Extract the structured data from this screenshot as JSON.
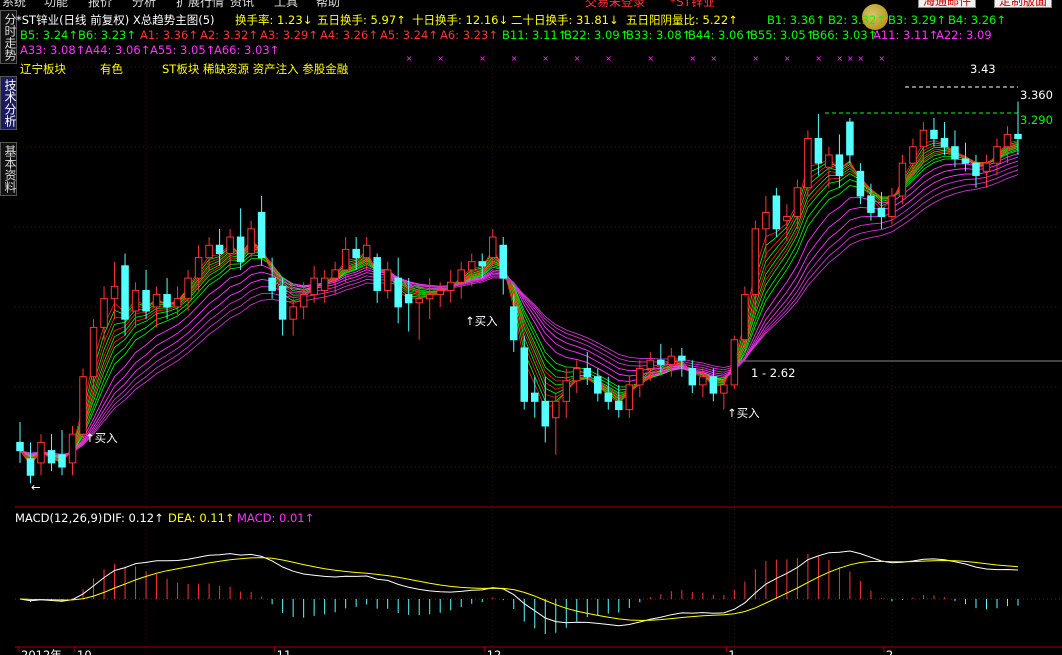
{
  "menu": {
    "items": [
      "系统",
      "功能",
      "报价",
      "分析",
      "扩展行情",
      "资讯",
      "工具",
      "帮助"
    ],
    "center": [
      "交易未登录",
      "*ST锌业"
    ],
    "buttons": [
      "海通邮件",
      "定制版面"
    ]
  },
  "sidetabs": [
    "分时走势",
    "技术分析",
    "基本资料"
  ],
  "header": {
    "title": "*ST锌业(日线 前复权) X总趋势主图(5)",
    "stats": [
      {
        "label": "换手率:",
        "value": "1.23",
        "dir": "down"
      },
      {
        "label": "五日换手:",
        "value": "5.97",
        "dir": "up"
      },
      {
        "label": "十日换手:",
        "value": "12.16",
        "dir": "down"
      },
      {
        "label": "二十日换手:",
        "value": "31.81",
        "dir": "down"
      },
      {
        "label": "五日阳阴量比:",
        "value": "5.22",
        "dir": "up"
      }
    ],
    "ma_row1": [
      {
        "name": "B1:",
        "value": "3.36",
        "dir": "up",
        "color": "#00ff00"
      },
      {
        "name": "B2:",
        "value": "3.32",
        "dir": "up",
        "color": "#00ff00"
      },
      {
        "name": "B3:",
        "value": "3.29",
        "dir": "up",
        "color": "#00ff00"
      },
      {
        "name": "B4:",
        "value": "3.26",
        "dir": "up",
        "color": "#00ff00"
      }
    ],
    "ma_row2": [
      {
        "name": "B5:",
        "value": "3.24",
        "dir": "up",
        "color": "#00ff00"
      },
      {
        "name": "B6:",
        "value": "3.23",
        "dir": "up",
        "color": "#00ff00"
      },
      {
        "name": "A1:",
        "value": "3.36",
        "dir": "up",
        "color": "#ff3333"
      },
      {
        "name": "A2:",
        "value": "3.32",
        "dir": "up",
        "color": "#ff3333"
      },
      {
        "name": "A3:",
        "value": "3.29",
        "dir": "up",
        "color": "#ff3333"
      },
      {
        "name": "A4:",
        "value": "3.26",
        "dir": "up",
        "color": "#ff3333"
      },
      {
        "name": "A5:",
        "value": "3.24",
        "dir": "up",
        "color": "#ff3333"
      },
      {
        "name": "A6:",
        "value": "3.23",
        "dir": "up",
        "color": "#ff3333"
      },
      {
        "name": "B11:",
        "value": "3.11",
        "dir": "up",
        "color": "#00ff00"
      },
      {
        "name": "B22:",
        "value": "3.09",
        "dir": "up",
        "color": "#00ff00"
      },
      {
        "name": "B33:",
        "value": "3.08",
        "dir": "up",
        "color": "#00ff00"
      },
      {
        "name": "B44:",
        "value": "3.06",
        "dir": "up",
        "color": "#00ff00"
      },
      {
        "name": "B55:",
        "value": "3.05",
        "dir": "up",
        "color": "#00ff00"
      },
      {
        "name": "B66:",
        "value": "3.03",
        "dir": "up",
        "color": "#00ff00"
      },
      {
        "name": "A11:",
        "value": "3.11",
        "dir": "up",
        "color": "#ff33ff"
      },
      {
        "name": "A22:",
        "value": "3.09",
        "dir": "",
        "color": "#ff33ff"
      }
    ],
    "ma_row3": [
      {
        "name": "A33:",
        "value": "3.08",
        "dir": "up",
        "color": "#ff33ff"
      },
      {
        "name": "A44:",
        "value": "3.06",
        "dir": "up",
        "color": "#ff33ff"
      },
      {
        "name": "A55:",
        "value": "3.05",
        "dir": "up",
        "color": "#ff33ff"
      },
      {
        "name": "A66:",
        "value": "3.03",
        "dir": "up",
        "color": "#ff33ff"
      }
    ],
    "tags": [
      "辽宁板块",
      "有色",
      "ST板块 稀缺资源 资产注入 参股金融"
    ]
  },
  "annotations": {
    "buy_label": "↑买入",
    "price_tags": [
      "3.43",
      "3.360",
      "3.290"
    ],
    "low_tag": "1 - 2.62",
    "left_arrow": "←"
  },
  "macd": {
    "title": "MACD(12,26,9)",
    "dif": {
      "label": "DIF:",
      "value": "0.12",
      "dir": "up"
    },
    "dea": {
      "label": "DEA:",
      "value": "0.11",
      "dir": "up"
    },
    "macd": {
      "label": "MACD:",
      "value": "0.01",
      "dir": "up"
    }
  },
  "chart_data": {
    "type": "candlestick",
    "dates": [
      "2012年",
      "10",
      "11",
      "12",
      "1",
      "2"
    ],
    "y_range": [
      2.45,
      3.48
    ],
    "candles": [
      {
        "o": 2.6,
        "h": 2.65,
        "l": 2.55,
        "c": 2.58
      },
      {
        "o": 2.56,
        "h": 2.6,
        "l": 2.5,
        "c": 2.52
      },
      {
        "o": 2.55,
        "h": 2.62,
        "l": 2.52,
        "c": 2.6
      },
      {
        "o": 2.58,
        "h": 2.62,
        "l": 2.53,
        "c": 2.55
      },
      {
        "o": 2.57,
        "h": 2.63,
        "l": 2.52,
        "c": 2.54
      },
      {
        "o": 2.55,
        "h": 2.64,
        "l": 2.52,
        "c": 2.62
      },
      {
        "o": 2.62,
        "h": 2.78,
        "l": 2.6,
        "c": 2.76
      },
      {
        "o": 2.76,
        "h": 2.9,
        "l": 2.73,
        "c": 2.88
      },
      {
        "o": 2.88,
        "h": 2.98,
        "l": 2.85,
        "c": 2.95
      },
      {
        "o": 2.95,
        "h": 3.04,
        "l": 2.9,
        "c": 2.98
      },
      {
        "o": 3.03,
        "h": 3.06,
        "l": 2.86,
        "c": 2.9
      },
      {
        "o": 2.92,
        "h": 2.99,
        "l": 2.88,
        "c": 2.97
      },
      {
        "o": 2.97,
        "h": 3.02,
        "l": 2.9,
        "c": 2.92
      },
      {
        "o": 2.93,
        "h": 2.98,
        "l": 2.88,
        "c": 2.96
      },
      {
        "o": 2.96,
        "h": 3.0,
        "l": 2.9,
        "c": 2.93
      },
      {
        "o": 2.93,
        "h": 2.98,
        "l": 2.91,
        "c": 2.95
      },
      {
        "o": 2.95,
        "h": 3.02,
        "l": 2.92,
        "c": 3.0
      },
      {
        "o": 3.0,
        "h": 3.08,
        "l": 2.97,
        "c": 3.05
      },
      {
        "o": 3.05,
        "h": 3.1,
        "l": 3.02,
        "c": 3.08
      },
      {
        "o": 3.08,
        "h": 3.12,
        "l": 3.03,
        "c": 3.06
      },
      {
        "o": 3.06,
        "h": 3.12,
        "l": 3.02,
        "c": 3.1
      },
      {
        "o": 3.1,
        "h": 3.17,
        "l": 3.02,
        "c": 3.04
      },
      {
        "o": 3.06,
        "h": 3.14,
        "l": 3.05,
        "c": 3.12
      },
      {
        "o": 3.16,
        "h": 3.2,
        "l": 3.03,
        "c": 3.05
      },
      {
        "o": 3.0,
        "h": 3.05,
        "l": 2.95,
        "c": 2.97
      },
      {
        "o": 2.98,
        "h": 3.0,
        "l": 2.86,
        "c": 2.9
      },
      {
        "o": 2.9,
        "h": 2.95,
        "l": 2.86,
        "c": 2.93
      },
      {
        "o": 2.93,
        "h": 2.99,
        "l": 2.9,
        "c": 2.96
      },
      {
        "o": 2.96,
        "h": 3.03,
        "l": 2.94,
        "c": 3.0
      },
      {
        "o": 2.97,
        "h": 3.02,
        "l": 2.94,
        "c": 3.0
      },
      {
        "o": 3.0,
        "h": 3.04,
        "l": 2.96,
        "c": 3.02
      },
      {
        "o": 3.02,
        "h": 3.1,
        "l": 2.99,
        "c": 3.07
      },
      {
        "o": 3.07,
        "h": 3.1,
        "l": 3.02,
        "c": 3.05
      },
      {
        "o": 3.05,
        "h": 3.1,
        "l": 3.02,
        "c": 3.08
      },
      {
        "o": 3.05,
        "h": 3.06,
        "l": 2.94,
        "c": 2.97
      },
      {
        "o": 2.97,
        "h": 3.04,
        "l": 2.95,
        "c": 3.02
      },
      {
        "o": 3.0,
        "h": 3.05,
        "l": 2.89,
        "c": 2.93
      },
      {
        "o": 2.96,
        "h": 3.0,
        "l": 2.87,
        "c": 2.94
      },
      {
        "o": 2.94,
        "h": 2.98,
        "l": 2.85,
        "c": 2.95
      },
      {
        "o": 2.95,
        "h": 3.0,
        "l": 2.9,
        "c": 2.96
      },
      {
        "o": 2.96,
        "h": 2.99,
        "l": 2.93,
        "c": 2.97
      },
      {
        "o": 2.97,
        "h": 3.02,
        "l": 2.94,
        "c": 2.99
      },
      {
        "o": 2.99,
        "h": 3.04,
        "l": 2.95,
        "c": 3.02
      },
      {
        "o": 3.02,
        "h": 3.06,
        "l": 2.98,
        "c": 3.04
      },
      {
        "o": 3.04,
        "h": 3.06,
        "l": 3.0,
        "c": 3.03
      },
      {
        "o": 3.05,
        "h": 3.12,
        "l": 3.03,
        "c": 3.1
      },
      {
        "o": 3.08,
        "h": 3.1,
        "l": 2.96,
        "c": 3.0
      },
      {
        "o": 2.93,
        "h": 2.96,
        "l": 2.82,
        "c": 2.85
      },
      {
        "o": 2.83,
        "h": 2.86,
        "l": 2.68,
        "c": 2.7
      },
      {
        "o": 2.72,
        "h": 2.76,
        "l": 2.66,
        "c": 2.7
      },
      {
        "o": 2.7,
        "h": 2.76,
        "l": 2.6,
        "c": 2.64
      },
      {
        "o": 2.66,
        "h": 2.72,
        "l": 2.57,
        "c": 2.7
      },
      {
        "o": 2.7,
        "h": 2.78,
        "l": 2.66,
        "c": 2.75
      },
      {
        "o": 2.75,
        "h": 2.8,
        "l": 2.72,
        "c": 2.78
      },
      {
        "o": 2.78,
        "h": 2.82,
        "l": 2.74,
        "c": 2.76
      },
      {
        "o": 2.76,
        "h": 2.78,
        "l": 2.7,
        "c": 2.72
      },
      {
        "o": 2.72,
        "h": 2.76,
        "l": 2.68,
        "c": 2.7
      },
      {
        "o": 2.7,
        "h": 2.74,
        "l": 2.66,
        "c": 2.68
      },
      {
        "o": 2.68,
        "h": 2.76,
        "l": 2.66,
        "c": 2.74
      },
      {
        "o": 2.74,
        "h": 2.8,
        "l": 2.71,
        "c": 2.78
      },
      {
        "o": 2.78,
        "h": 2.82,
        "l": 2.75,
        "c": 2.8
      },
      {
        "o": 2.8,
        "h": 2.84,
        "l": 2.77,
        "c": 2.79
      },
      {
        "o": 2.79,
        "h": 2.83,
        "l": 2.76,
        "c": 2.81
      },
      {
        "o": 2.81,
        "h": 2.83,
        "l": 2.76,
        "c": 2.8
      },
      {
        "o": 2.78,
        "h": 2.8,
        "l": 2.72,
        "c": 2.74
      },
      {
        "o": 2.74,
        "h": 2.78,
        "l": 2.71,
        "c": 2.76
      },
      {
        "o": 2.76,
        "h": 2.78,
        "l": 2.7,
        "c": 2.72
      },
      {
        "o": 2.72,
        "h": 2.76,
        "l": 2.68,
        "c": 2.74
      },
      {
        "o": 2.74,
        "h": 2.86,
        "l": 2.73,
        "c": 2.85
      },
      {
        "o": 2.85,
        "h": 2.98,
        "l": 2.83,
        "c": 2.96
      },
      {
        "o": 2.96,
        "h": 3.14,
        "l": 2.92,
        "c": 3.12
      },
      {
        "o": 3.12,
        "h": 3.2,
        "l": 3.05,
        "c": 3.16
      },
      {
        "o": 3.2,
        "h": 3.22,
        "l": 3.1,
        "c": 3.12
      },
      {
        "o": 3.14,
        "h": 3.18,
        "l": 3.09,
        "c": 3.15
      },
      {
        "o": 3.15,
        "h": 3.24,
        "l": 3.12,
        "c": 3.22
      },
      {
        "o": 3.22,
        "h": 3.36,
        "l": 3.2,
        "c": 3.34
      },
      {
        "o": 3.34,
        "h": 3.4,
        "l": 3.25,
        "c": 3.28
      },
      {
        "o": 3.27,
        "h": 3.32,
        "l": 3.22,
        "c": 3.3
      },
      {
        "o": 3.3,
        "h": 3.35,
        "l": 3.22,
        "c": 3.25
      },
      {
        "o": 3.38,
        "h": 3.39,
        "l": 3.28,
        "c": 3.3
      },
      {
        "o": 3.26,
        "h": 3.28,
        "l": 3.18,
        "c": 3.2
      },
      {
        "o": 3.2,
        "h": 3.23,
        "l": 3.14,
        "c": 3.16
      },
      {
        "o": 3.17,
        "h": 3.21,
        "l": 3.12,
        "c": 3.15
      },
      {
        "o": 3.15,
        "h": 3.22,
        "l": 3.13,
        "c": 3.2
      },
      {
        "o": 3.2,
        "h": 3.3,
        "l": 3.18,
        "c": 3.28
      },
      {
        "o": 3.28,
        "h": 3.34,
        "l": 3.26,
        "c": 3.32
      },
      {
        "o": 3.32,
        "h": 3.38,
        "l": 3.28,
        "c": 3.36
      },
      {
        "o": 3.36,
        "h": 3.39,
        "l": 3.32,
        "c": 3.34
      },
      {
        "o": 3.34,
        "h": 3.38,
        "l": 3.3,
        "c": 3.32
      },
      {
        "o": 3.32,
        "h": 3.36,
        "l": 3.27,
        "c": 3.29
      },
      {
        "o": 3.29,
        "h": 3.33,
        "l": 3.26,
        "c": 3.28
      },
      {
        "o": 3.28,
        "h": 3.3,
        "l": 3.22,
        "c": 3.25
      },
      {
        "o": 3.26,
        "h": 3.3,
        "l": 3.22,
        "c": 3.28
      },
      {
        "o": 3.28,
        "h": 3.34,
        "l": 3.25,
        "c": 3.32
      },
      {
        "o": 3.32,
        "h": 3.37,
        "l": 3.28,
        "c": 3.35
      },
      {
        "o": 3.35,
        "h": 3.43,
        "l": 3.3,
        "c": 3.34
      }
    ]
  }
}
